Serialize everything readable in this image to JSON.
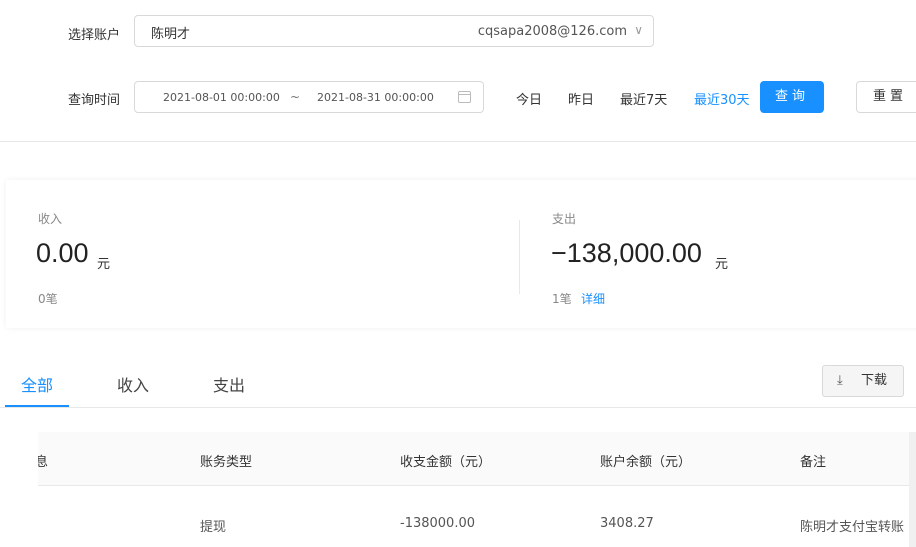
{
  "filter": {
    "account_label": "选择账户",
    "account_name": "陈明才",
    "account_email": "cqsapa2008@126.com",
    "time_label": "查询时间",
    "start_date": "2021-08-01 00:00:00",
    "range_sep": "~",
    "end_date": "2021-08-31 00:00:00",
    "quick_ranges": [
      "今日",
      "昨日",
      "最近7天",
      "最近30天"
    ],
    "active_range": "最近30天",
    "query_label": "查询",
    "reset_label": "重置"
  },
  "summary": {
    "income": {
      "label": "收入",
      "amount": "0.00",
      "unit": "元",
      "count": "0笔"
    },
    "expense": {
      "label": "支出",
      "amount": "−138,000.00",
      "unit": "元",
      "count": "1笔",
      "detail_link": "详细"
    }
  },
  "tabs": [
    "全部",
    "收入",
    "支出"
  ],
  "active_tab": "全部",
  "download_label": "下载",
  "table": {
    "columns": [
      "信息",
      "账务类型",
      "收支金额（元）",
      "账户余额（元）",
      "备注"
    ],
    "rows": [
      [
        "",
        "提现",
        "-138000.00",
        "3408.27",
        "陈明才支付宝转账"
      ]
    ]
  },
  "colors": {
    "primary": "#1890ff",
    "border": "#d9d9d9",
    "header_bg": "#fafafa"
  }
}
